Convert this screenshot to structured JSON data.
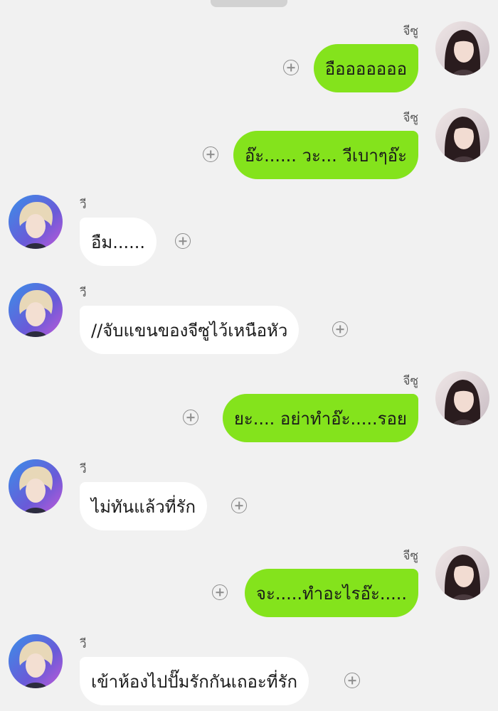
{
  "chat": {
    "messages": [
      {
        "sender": "จีซู",
        "text": "อือออออออ",
        "side": "right"
      },
      {
        "sender": "จีซู",
        "text": "อ๊ะ...... วะ... วีเบาๆอ๊ะ",
        "side": "right"
      },
      {
        "sender": "วี",
        "text": "อืม......",
        "side": "left"
      },
      {
        "sender": "วี",
        "text": "//จับแขนของจีซูไว้เหนือหัว",
        "side": "left"
      },
      {
        "sender": "จีซู",
        "text": "ยะ.... อย่าทำอ๊ะ.....รอย",
        "side": "right"
      },
      {
        "sender": "วี",
        "text": "ไม่ทันแล้วที่รัก",
        "side": "left"
      },
      {
        "sender": "จีซู",
        "text": "จะ.....ทำอะไรอ๊ะ.....",
        "side": "right"
      },
      {
        "sender": "วี",
        "text": "เข้าห้องไปปั๊มรักกันเถอะที่รัก",
        "side": "left"
      }
    ]
  },
  "colors": {
    "background": "#f1f1f1",
    "sent_bubble": "#84e31c",
    "received_bubble": "#ffffff",
    "icon_gray": "#8d8d8d"
  },
  "icons": {
    "add": "plus-circle-icon"
  }
}
